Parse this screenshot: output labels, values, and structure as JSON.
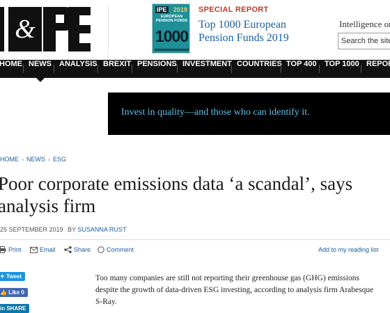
{
  "header": {
    "logo_text": "IPE",
    "special_report": {
      "label": "SPECIAL REPORT",
      "title": "Top 1000 European Pension Funds 2019",
      "cover": {
        "brand": "IPE",
        "year": "2019",
        "subtitle": "EUROPEAN PENSION FUNDS",
        "number": "1000"
      }
    },
    "tagline": "Intelligence on",
    "search_placeholder": "Search the site"
  },
  "nav": {
    "items": [
      {
        "label": "HOME"
      },
      {
        "label": "NEWS"
      },
      {
        "label": "ANALYSIS"
      },
      {
        "label": "BREXIT"
      },
      {
        "label": "PENSIONS"
      },
      {
        "label": "INVESTMENT"
      },
      {
        "label": "COUNTRIES"
      },
      {
        "label": "TOP 400"
      },
      {
        "label": "TOP 1000"
      },
      {
        "label": "REPORTS"
      }
    ],
    "active": "NEWS"
  },
  "banner": {
    "text": "Invest in quality—and those who can identify it."
  },
  "breadcrumb": [
    "HOME",
    "NEWS",
    "ESG"
  ],
  "article": {
    "title": "Poor corporate emissions data ‘a scandal’, says analysis firm",
    "date": "25 SEPTEMBER 2019",
    "by_label": "BY",
    "author": "SUSANNA RUST",
    "actions": {
      "print": "Print",
      "email": "Email",
      "share": "Share",
      "comment": "Comment",
      "reading_list": "Add to my reading list"
    },
    "body": "Too many companies are still not reporting their greenhouse gas (GHG) emissions despite the growth of data-driven ESG investing, according to analysis firm Arabesque S-Ray."
  },
  "social": {
    "tweet": "Tweet",
    "like": "Like 0",
    "share": "SHARE"
  },
  "colors": {
    "nav_bg": "#111111",
    "link_blue": "#1a5fa0",
    "special_red": "#c0392b",
    "banner_text": "#5ec0e8"
  }
}
